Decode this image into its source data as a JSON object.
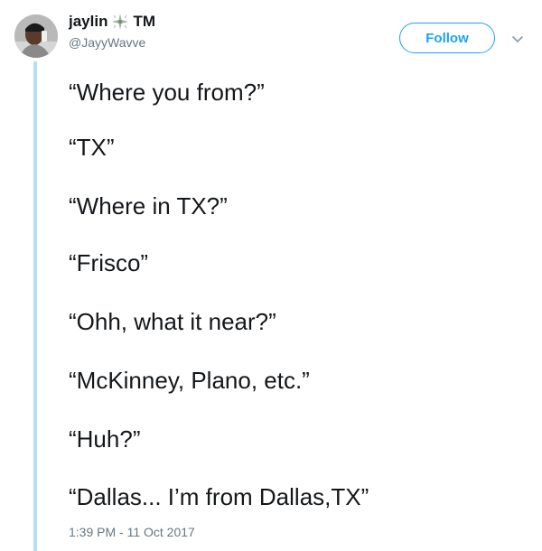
{
  "user": {
    "display_name": "jaylin",
    "name_suffix": "TM",
    "handle": "@JayyWavve",
    "name_emoji": "sparkle-icon"
  },
  "header": {
    "follow_label": "Follow",
    "menu_icon": "chevron-down-icon",
    "accent_color": "#1da1f2"
  },
  "tweet": {
    "lines": [
      "“Where you from?”",
      "“TX”",
      "“Where in TX?”",
      "“Frisco”",
      "“Ohh, what it near?”",
      "“McKinney, Plano, etc.”",
      "“Huh?”",
      "“Dallas... I’m from Dallas,TX”"
    ],
    "timestamp": "1:39 PM - 11 Oct 2017"
  }
}
